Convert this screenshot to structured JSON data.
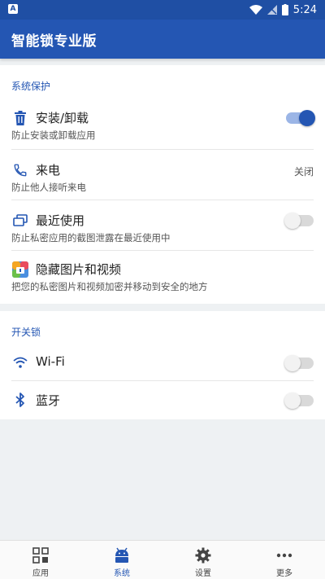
{
  "status_bar": {
    "time": "5:24"
  },
  "app": {
    "title": "智能锁专业版"
  },
  "colors": {
    "primary": "#2456b3",
    "status_bar": "#1f4fa4",
    "toggle_on": "#2456b3"
  },
  "system_protection": {
    "section_title": "系统保护",
    "items": [
      {
        "icon": "trash-icon",
        "title": "安装/卸载",
        "subtitle": "防止安装或卸载应用",
        "control": "toggle",
        "on": true
      },
      {
        "icon": "phone-icon",
        "title": "来电",
        "subtitle": "防止他人接听来电",
        "control": "value",
        "value": "关闭"
      },
      {
        "icon": "recent-apps-icon",
        "title": "最近使用",
        "subtitle": "防止私密应用的截图泄露在最近使用中",
        "control": "toggle",
        "on": false
      },
      {
        "icon": "gallery-icon",
        "title": "隐藏图片和视频",
        "subtitle": "把您的私密图片和视频加密并移动到安全的地方",
        "control": "none"
      }
    ]
  },
  "switch_lock": {
    "section_title": "开关锁",
    "items": [
      {
        "icon": "wifi-icon",
        "title": "Wi-Fi",
        "control": "toggle",
        "on": false
      },
      {
        "icon": "bluetooth-icon",
        "title": "蓝牙",
        "control": "toggle",
        "on": false
      }
    ]
  },
  "bottom_nav": [
    {
      "icon": "grid-icon",
      "label": "应用",
      "active": false
    },
    {
      "icon": "android-icon",
      "label": "系统",
      "active": true
    },
    {
      "icon": "gear-icon",
      "label": "设置",
      "active": false
    },
    {
      "icon": "more-icon",
      "label": "更多",
      "active": false
    }
  ]
}
